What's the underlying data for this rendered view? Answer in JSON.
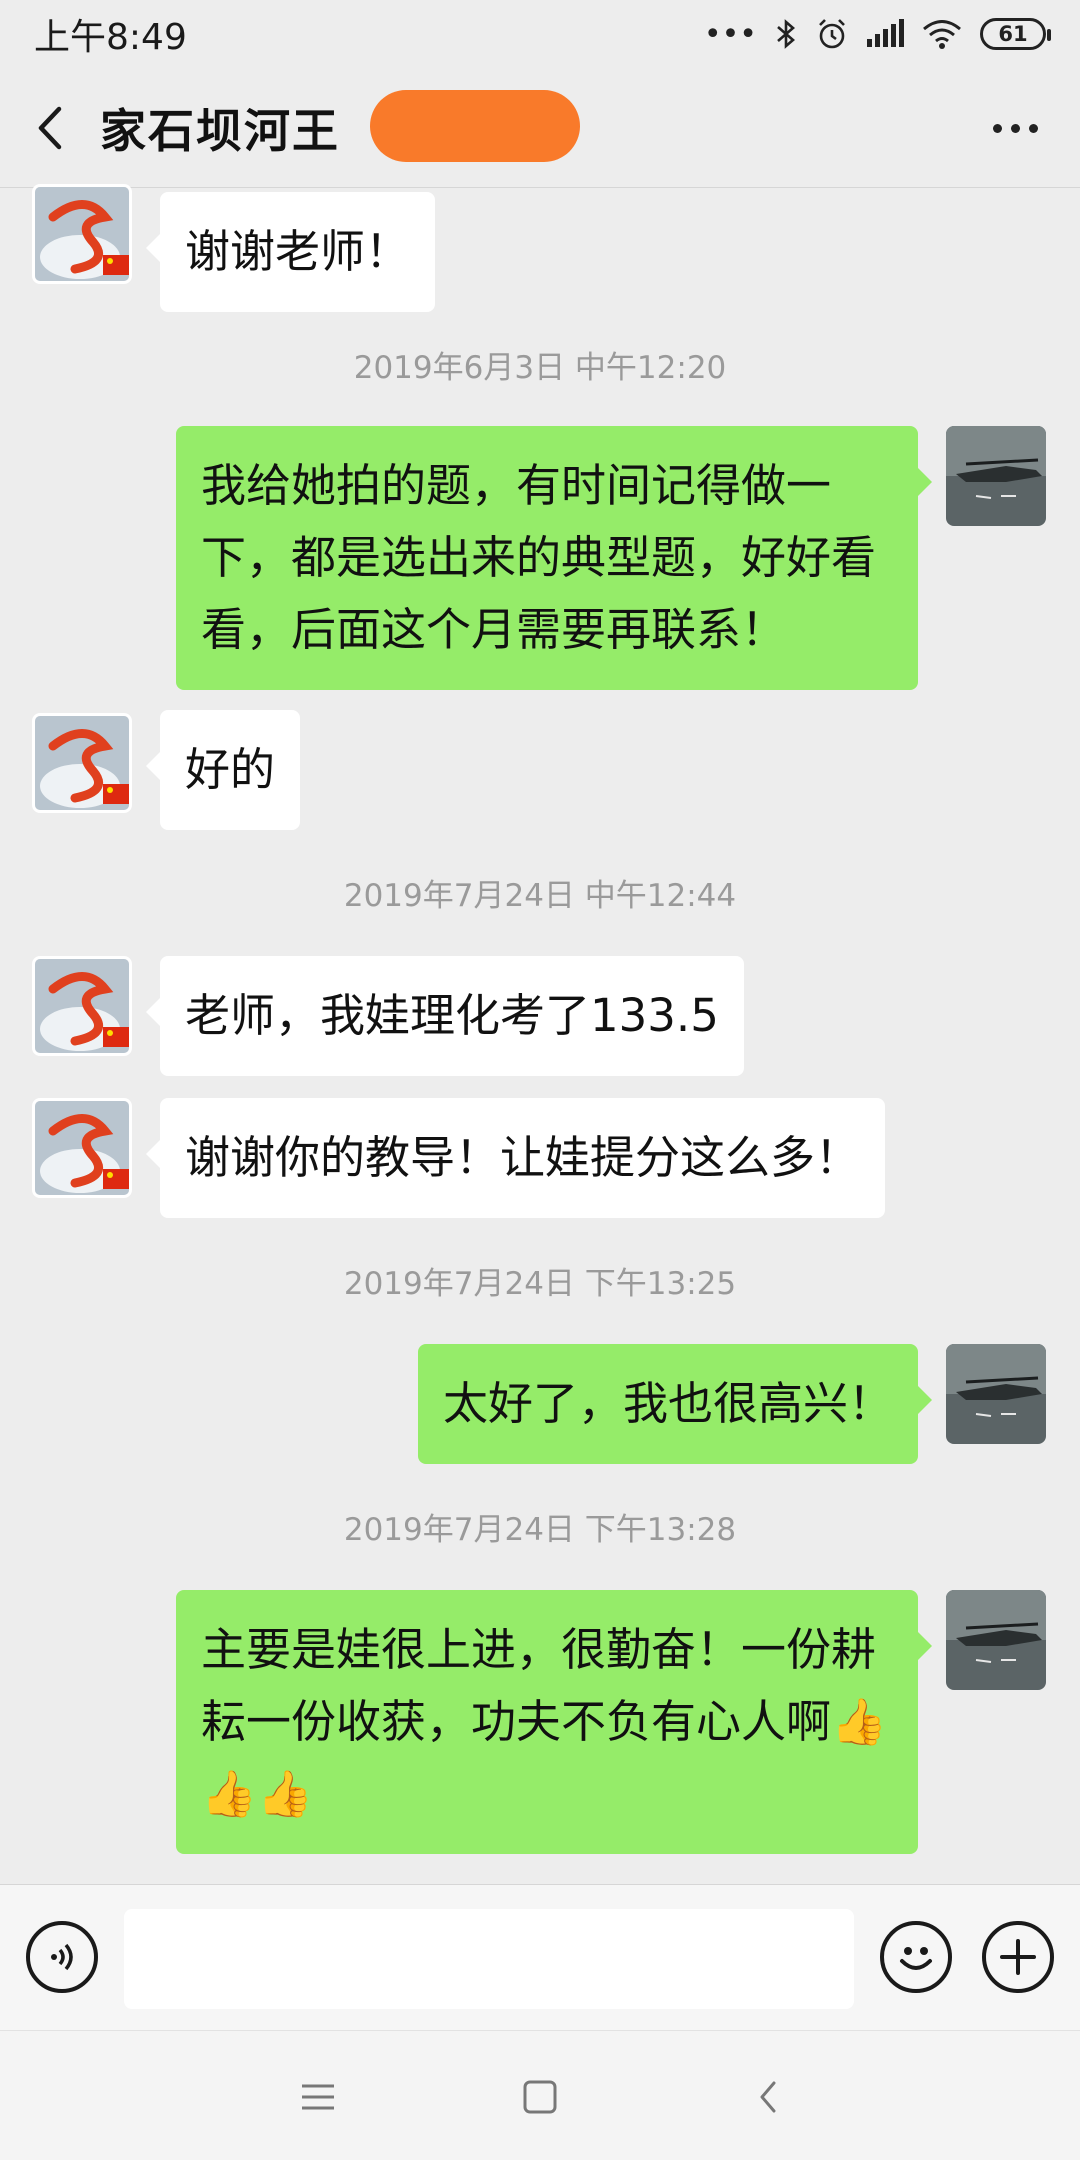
{
  "status_bar": {
    "time": "上午8:49",
    "signal_dots": "•••",
    "battery": "61"
  },
  "header": {
    "back_icon": "chevron-left-icon",
    "title": "家石坝河王",
    "more_icon": "ellipsis-icon"
  },
  "messages": [
    {
      "side": "left",
      "text": "谢谢老师！"
    },
    {
      "timestamp": "2019年6月3日 中午12:20"
    },
    {
      "side": "right",
      "text": "我给她拍的题，有时间记得做一下，都是选出来的典型题，好好看看，后面这个月需要再联系！"
    },
    {
      "side": "left",
      "text": "好的"
    },
    {
      "timestamp": "2019年7月24日 中午12:44"
    },
    {
      "side": "left",
      "text": "老师，我娃理化考了133.5"
    },
    {
      "side": "left",
      "text": "谢谢你的教导！让娃提分这么多！"
    },
    {
      "timestamp": "2019年7月24日 下午13:25"
    },
    {
      "side": "right",
      "text": "太好了，我也很高兴！"
    },
    {
      "timestamp": "2019年7月24日 下午13:28"
    },
    {
      "side": "right",
      "text": "主要是娃很上进，很勤奋！一份耕耘一份收获，功夫不负有心人啊👍👍👍"
    }
  ],
  "input_bar": {
    "voice_icon": "voice-icon",
    "emoji_icon": "emoji-icon",
    "add_icon": "plus-icon",
    "input_value": ""
  },
  "system_nav": {
    "menu_icon": "menu-icon",
    "home_icon": "home-icon",
    "back_icon": "back-triangle-icon"
  },
  "colors": {
    "background": "#ededed",
    "sent_bubble": "#95ec69",
    "received_bubble": "#ffffff",
    "redaction": "#f97a2a"
  }
}
